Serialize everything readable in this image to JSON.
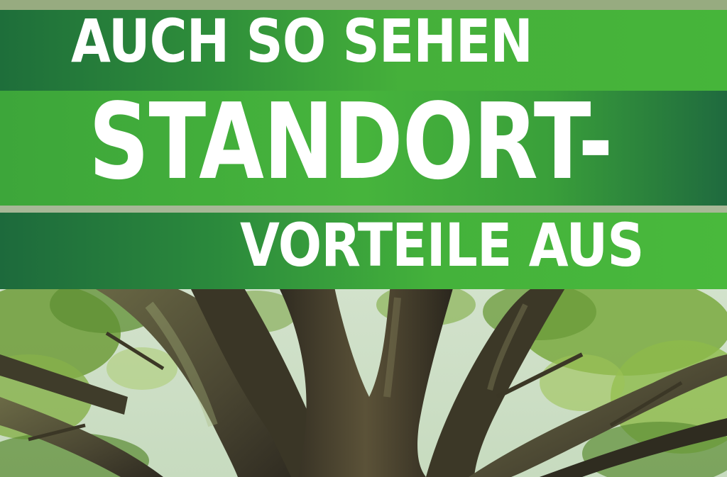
{
  "poster": {
    "headline_line_1": "AUCH SO SEHEN",
    "headline_line_2": "STANDORT-",
    "headline_line_3": "VORTEILE AUS"
  },
  "colors": {
    "band_dark_green": "#1e6e3a",
    "band_bright_green": "#46b53a",
    "text_white": "#ffffff",
    "foliage_green": "#6f9e3a",
    "trunk_brown": "#4a3e2c",
    "sky": "#d7e6d2"
  },
  "icons": {
    "background": "tree-canopy-photo"
  }
}
